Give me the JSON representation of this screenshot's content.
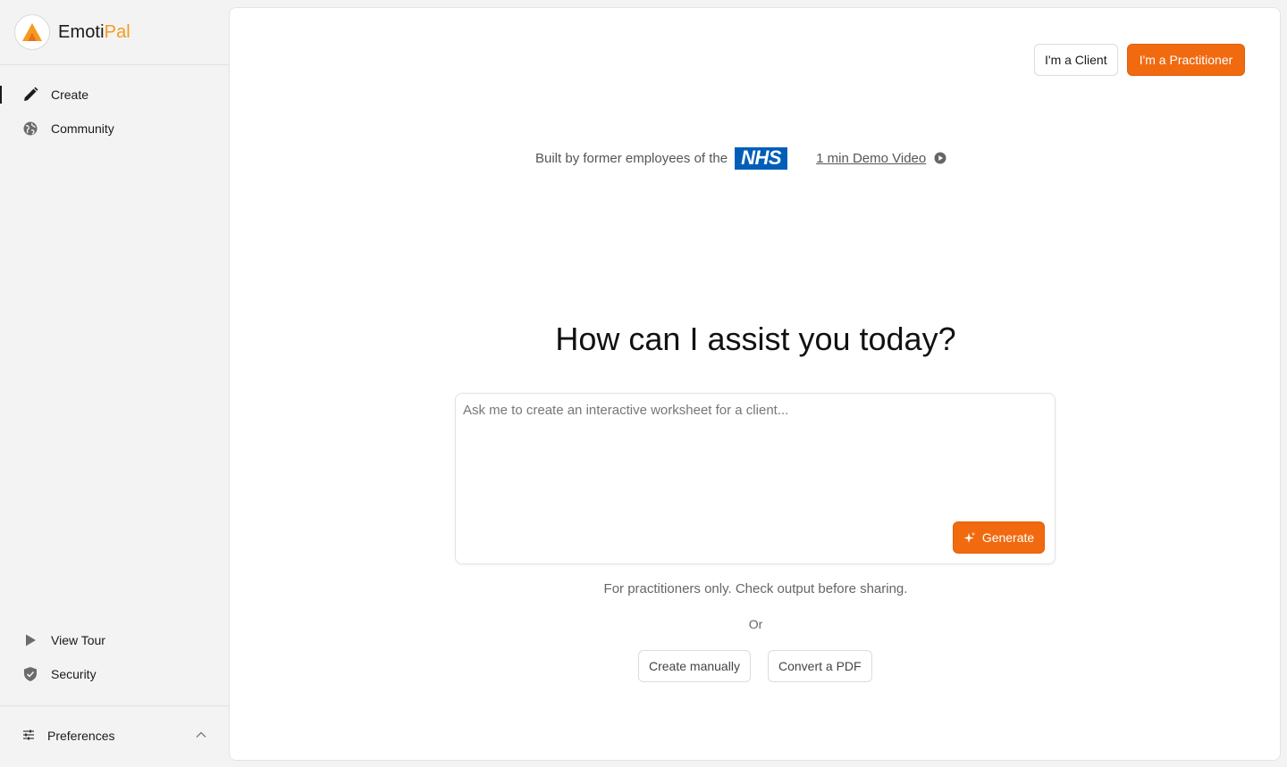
{
  "brand": {
    "name_part1": "Emoti",
    "name_part2": "Pal",
    "accent_color": "#f59a1d"
  },
  "sidebar": {
    "nav": [
      {
        "label": "Create",
        "icon": "pencil-icon",
        "active": true
      },
      {
        "label": "Community",
        "icon": "globe-icon",
        "active": false
      }
    ],
    "bottom": [
      {
        "label": "View Tour",
        "icon": "play-icon"
      },
      {
        "label": "Security",
        "icon": "shield-icon"
      }
    ],
    "preferences": {
      "label": "Preferences",
      "icon": "sliders-icon",
      "expanded": true
    }
  },
  "header": {
    "client_label": "I'm a Client",
    "practitioner_label": "I'm a Practitioner",
    "primary_color": "#f16a10"
  },
  "trust": {
    "built_by": "Built by former employees of the",
    "nhs_logo": "NHS",
    "demo_link": "1 min Demo Video"
  },
  "main": {
    "headline": "How can I assist you today?",
    "prompt_placeholder": "Ask me to create an interactive worksheet for a client...",
    "generate_label": "Generate",
    "disclaimer": "For practitioners only. Check output before sharing.",
    "or_label": "Or",
    "create_manually_label": "Create manually",
    "convert_pdf_label": "Convert a PDF"
  }
}
